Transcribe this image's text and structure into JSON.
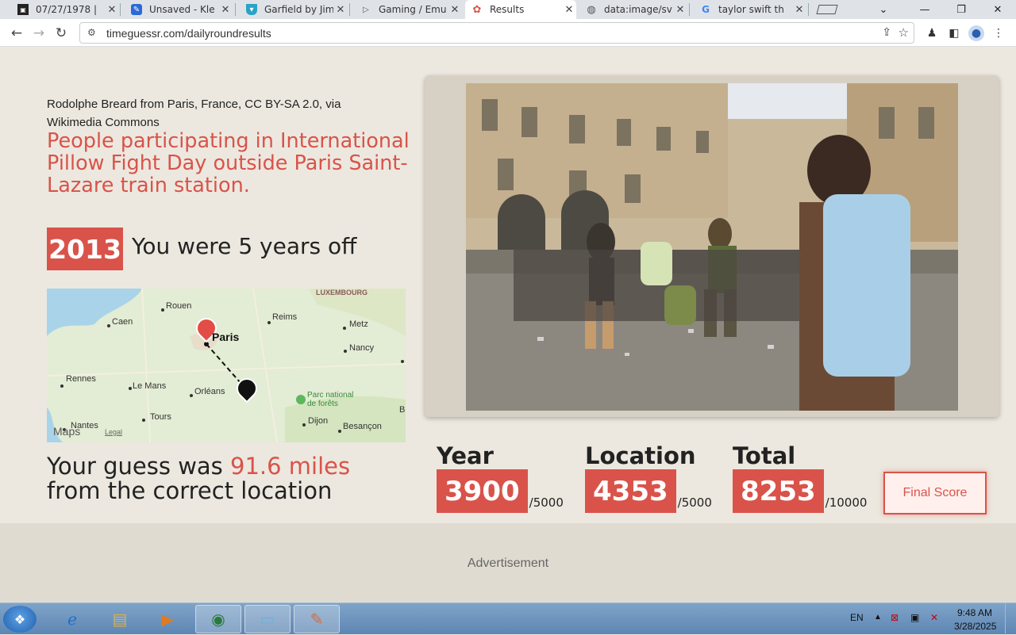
{
  "browser": {
    "tabs": [
      {
        "title": "07/27/1978 | ",
        "icon": "site-icon",
        "active": false
      },
      {
        "title": "Unsaved - Kle",
        "icon": "kleki-icon",
        "active": false
      },
      {
        "title": "Garfield by Jim",
        "icon": "shield-icon",
        "active": false
      },
      {
        "title": "Gaming / Emu",
        "icon": "play-icon",
        "active": false
      },
      {
        "title": "Results",
        "icon": "timeguessr-icon",
        "active": true
      },
      {
        "title": "data:image/sv",
        "icon": "globe-icon",
        "active": false
      },
      {
        "title": "taylor swift th",
        "icon": "google-icon",
        "active": false
      }
    ],
    "url": "timeguessr.com/dailyroundresults"
  },
  "result": {
    "credit": "Rodolphe Breard from Paris, France, CC BY-SA 2.0, via Wikimedia Commons",
    "description": "People participating in International Pillow Fight Day outside Paris Saint-Lazare train station.",
    "year": "2013",
    "years_off": "You were 5 years off",
    "distance_prefix": "Your guess was ",
    "distance_value": "91.6 miles",
    "distance_suffix": "from the correct location"
  },
  "map": {
    "labels": {
      "luxembourg": "LUXEMBOURG",
      "rouen": "Rouen",
      "caen": "Caen",
      "reims": "Reims",
      "metz": "Metz",
      "paris": "Paris",
      "nancy": "Nancy",
      "rennes": "Rennes",
      "le_mans": "Le Mans",
      "orleans": "Orléans",
      "parc": "Parc national",
      "parc2": "de forêts",
      "nantes": "Nantes",
      "tours": "Tours",
      "dijon": "Dijon",
      "besancon": "Besançon",
      "maps": "Maps",
      "legal": "Legal",
      "b": "B"
    }
  },
  "scores": {
    "year_label": "Year",
    "year_score": "3900",
    "year_max": "/5000",
    "location_label": "Location",
    "location_score": "4353",
    "location_max": "/5000",
    "total_label": "Total",
    "total_score": "8253",
    "total_max": "/10000",
    "final_button": "Final Score"
  },
  "ad_label": "Advertisement",
  "tray": {
    "lang": "EN",
    "time": "9:48 AM",
    "date": "3/28/2025"
  },
  "colors": {
    "accent": "#d9534a",
    "page_bg": "#ece8df"
  }
}
